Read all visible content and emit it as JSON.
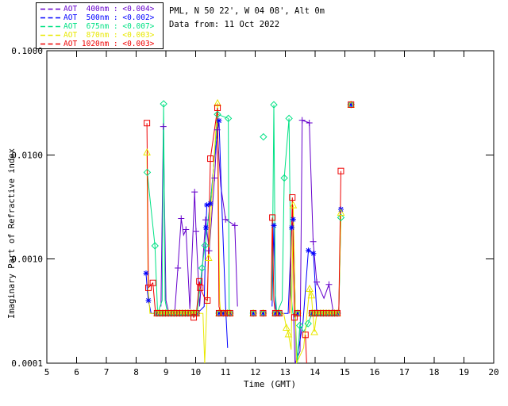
{
  "header": {
    "line1": "PML, N 50 22', W 04 08', Alt 0m",
    "line2": "Data from: 11 Oct 2022"
  },
  "chart_data": {
    "type": "line",
    "xlabel": "Time (GMT)",
    "ylabel": "Imaginary Part of Refractive index",
    "xlim": [
      5,
      20
    ],
    "ylim": [
      0.0001,
      0.1
    ],
    "y_scale": "log",
    "grid": false,
    "legend_position": "top-left-outside",
    "x_ticks": [
      5,
      6,
      7,
      8,
      9,
      10,
      11,
      12,
      13,
      14,
      15,
      16,
      17,
      18,
      19,
      20
    ],
    "y_ticks": [
      {
        "value": 0.1,
        "label": "0.1000"
      },
      {
        "value": 0.01,
        "label": "0.0100"
      },
      {
        "value": 0.001,
        "label": "0.0010"
      },
      {
        "value": 0.0001,
        "label": "0.0001"
      }
    ],
    "flat_value": 0.000302,
    "flat_times": [
      8.7,
      8.79,
      8.89,
      8.98,
      9.08,
      9.17,
      9.27,
      9.36,
      9.46,
      9.55,
      9.65,
      9.74,
      9.84,
      9.93,
      10.02,
      10.78,
      10.92,
      11.06,
      11.15,
      11.93,
      12.26,
      12.67,
      12.8,
      13.42,
      13.9,
      14.0,
      14.09,
      14.19,
      14.28,
      14.38,
      14.47,
      14.57,
      14.66,
      14.75
    ],
    "series": [
      {
        "name": "AOT 400nm",
        "legend_text": "AOT  400nm : <0.004>",
        "color": "#6600cc",
        "marker": "plus",
        "segments": [
          [
            [
              8.83,
              0.00035
            ],
            [
              8.91,
              0.0187
            ],
            [
              9.0,
              0.0004
            ],
            [
              9.1,
              0.0003
            ],
            [
              9.29,
              0.0003
            ],
            [
              9.4,
              0.00082
            ],
            [
              9.51,
              0.00245
            ],
            [
              9.59,
              0.0017
            ],
            [
              9.67,
              0.00192
            ],
            [
              9.8,
              0.00033
            ],
            [
              9.96,
              0.0044
            ],
            [
              10.01,
              0.00185
            ],
            [
              10.13,
              0.00035
            ],
            [
              10.33,
              0.00238
            ],
            [
              10.45,
              0.0012
            ],
            [
              10.63,
              0.006
            ],
            [
              10.72,
              0.0174
            ],
            [
              10.84,
              0.005
            ],
            [
              11.0,
              0.0024
            ],
            [
              11.31,
              0.0021
            ],
            [
              11.4,
              0.00035
            ]
          ],
          [
            [
              13.28,
              0.0003
            ],
            [
              13.33,
              0.0001
            ],
            [
              13.5,
              0.00013
            ],
            [
              13.57,
              0.0215
            ],
            [
              13.81,
              0.0203
            ],
            [
              13.94,
              0.00147
            ],
            [
              14.06,
              0.0006
            ],
            [
              14.3,
              0.00042
            ],
            [
              14.47,
              0.00057
            ],
            [
              14.62,
              0.0003
            ],
            [
              14.75,
              0.0003
            ]
          ]
        ],
        "markers": [
          [
            8.91,
            0.0187
          ],
          [
            9.4,
            0.00082
          ],
          [
            9.51,
            0.00245
          ],
          [
            9.67,
            0.00192
          ],
          [
            9.96,
            0.0044
          ],
          [
            10.01,
            0.00185
          ],
          [
            10.33,
            0.00238
          ],
          [
            10.45,
            0.0012
          ],
          [
            10.63,
            0.006
          ],
          [
            10.72,
            0.0174
          ],
          [
            11.0,
            0.0024
          ],
          [
            11.31,
            0.0021
          ],
          [
            13.57,
            0.0215
          ],
          [
            13.81,
            0.0203
          ],
          [
            13.94,
            0.00147
          ],
          [
            14.06,
            0.0006
          ],
          [
            14.47,
            0.00057
          ],
          [
            15.21,
            0.0304
          ]
        ]
      },
      {
        "name": "AOT 500nm",
        "legend_text": "AOT  500nm : <0.002>",
        "color": "#0000ff",
        "marker": "asterisk",
        "segments": [
          [
            [
              8.33,
              0.00073
            ],
            [
              8.37,
              0.0005
            ],
            [
              8.41,
              0.0004
            ],
            [
              8.5,
              0.0003
            ],
            [
              10.05,
              0.0003
            ],
            [
              10.28,
              0.00035
            ],
            [
              10.34,
              0.002
            ],
            [
              10.37,
              0.0033
            ],
            [
              10.49,
              0.0034
            ],
            [
              10.62,
              0.009
            ],
            [
              10.78,
              0.0213
            ],
            [
              10.88,
              0.003
            ],
            [
              11.0,
              0.00035
            ],
            [
              11.07,
              0.00014
            ]
          ],
          [
            [
              12.56,
              0.00035
            ],
            [
              12.62,
              0.0021
            ],
            [
              12.68,
              0.0003
            ],
            [
              13.1,
              0.0003
            ],
            [
              13.22,
              0.002
            ],
            [
              13.27,
              0.0024
            ],
            [
              13.33,
              0.00045
            ],
            [
              13.37,
              0.0001
            ],
            [
              13.6,
              0.00025
            ],
            [
              13.78,
              0.00121
            ],
            [
              13.95,
              0.00113
            ],
            [
              14.06,
              0.0003
            ],
            [
              14.75,
              0.0003
            ]
          ],
          [
            [
              14.8,
              0.0003
            ],
            [
              14.87,
              0.003
            ]
          ]
        ],
        "markers": [
          [
            8.33,
            0.00073
          ],
          [
            8.41,
            0.0004
          ],
          [
            10.34,
            0.002
          ],
          [
            10.37,
            0.0033
          ],
          [
            10.49,
            0.0034
          ],
          [
            10.78,
            0.0213
          ],
          [
            12.62,
            0.0021
          ],
          [
            13.22,
            0.002
          ],
          [
            13.27,
            0.0024
          ],
          [
            13.78,
            0.00121
          ],
          [
            13.95,
            0.00113
          ],
          [
            14.87,
            0.003
          ],
          [
            15.21,
            0.0304
          ]
        ]
      },
      {
        "name": "AOT 675nm",
        "legend_text": "AOT  675nm : <0.007>",
        "color": "#00e184",
        "marker": "diamond",
        "segments": [
          [
            [
              8.37,
              0.0068
            ],
            [
              8.63,
              0.00134
            ],
            [
              8.72,
              0.0003
            ],
            [
              8.87,
              0.0004
            ],
            [
              8.92,
              0.0309
            ],
            [
              8.97,
              0.0004
            ],
            [
              9.05,
              0.0003
            ],
            [
              10.05,
              0.0003
            ],
            [
              10.21,
              0.00082
            ],
            [
              10.31,
              0.00135
            ],
            [
              10.55,
              0.005
            ],
            [
              10.73,
              0.0245
            ],
            [
              11.09,
              0.0224
            ],
            [
              11.12,
              0.0003
            ],
            [
              11.16,
              0.0003
            ]
          ],
          [
            [
              12.56,
              0.0004
            ],
            [
              12.62,
              0.0303
            ],
            [
              12.67,
              0.00046
            ],
            [
              12.72,
              0.0003
            ],
            [
              12.9,
              0.0004
            ],
            [
              12.97,
              0.006
            ],
            [
              13.13,
              0.0224
            ],
            [
              13.2,
              0.00045
            ],
            [
              13.26,
              0.0003
            ],
            [
              13.33,
              0.0003
            ],
            [
              13.41,
              0.0001
            ],
            [
              13.49,
              0.00023
            ],
            [
              13.62,
              0.0002
            ],
            [
              13.77,
              0.00024
            ],
            [
              13.9,
              0.0003
            ],
            [
              14.75,
              0.0003
            ]
          ],
          [
            [
              14.8,
              0.0003
            ],
            [
              14.87,
              0.0025
            ]
          ]
        ],
        "markers": [
          [
            8.37,
            0.0068
          ],
          [
            8.63,
            0.00134
          ],
          [
            8.92,
            0.0309
          ],
          [
            10.21,
            0.00082
          ],
          [
            10.31,
            0.00135
          ],
          [
            10.73,
            0.0245
          ],
          [
            11.09,
            0.0224
          ],
          [
            12.27,
            0.0149
          ],
          [
            12.62,
            0.0303
          ],
          [
            12.97,
            0.006
          ],
          [
            13.13,
            0.0224
          ],
          [
            13.49,
            0.00023
          ],
          [
            13.77,
            0.00024
          ],
          [
            14.87,
            0.0025
          ],
          [
            15.21,
            0.0304
          ]
        ]
      },
      {
        "name": "AOT 870nm",
        "legend_text": "AOT  870nm : <0.003>",
        "color": "#e8e800",
        "marker": "triangle",
        "segments": [
          [
            [
              8.36,
              0.0106
            ],
            [
              8.4,
              0.00055
            ],
            [
              8.46,
              0.0003
            ],
            [
              10.24,
              0.0003
            ],
            [
              10.3,
              0.0001
            ],
            [
              10.43,
              0.00103
            ],
            [
              10.6,
              0.008
            ],
            [
              10.73,
              0.0315
            ],
            [
              10.8,
              0.0004
            ],
            [
              10.84,
              0.0003
            ],
            [
              11.08,
              0.0003
            ]
          ],
          [
            [
              12.67,
              0.0003
            ],
            [
              12.95,
              0.0003
            ],
            [
              13.04,
              0.00022
            ],
            [
              13.11,
              0.00019
            ],
            [
              13.2,
              0.000135
            ],
            [
              13.27,
              0.0033
            ],
            [
              13.38,
              0.0001
            ],
            [
              13.62,
              0.00014
            ],
            [
              13.82,
              0.00052
            ],
            [
              13.88,
              0.00045
            ],
            [
              13.98,
              0.0002
            ],
            [
              14.06,
              0.0003
            ],
            [
              14.75,
              0.0003
            ]
          ],
          [
            [
              14.8,
              0.0003
            ],
            [
              14.87,
              0.0028
            ]
          ]
        ],
        "markers": [
          [
            8.36,
            0.0106
          ],
          [
            10.43,
            0.00103
          ],
          [
            10.73,
            0.0315
          ],
          [
            13.04,
            0.00022
          ],
          [
            13.11,
            0.00019
          ],
          [
            13.27,
            0.0033
          ],
          [
            13.82,
            0.00052
          ],
          [
            13.88,
            0.00045
          ],
          [
            13.98,
            0.0002
          ],
          [
            14.87,
            0.0028
          ],
          [
            15.21,
            0.0304
          ]
        ]
      },
      {
        "name": "AOT 1020nm",
        "legend_text": "AOT 1020nm : <0.003>",
        "color": "#ee0000",
        "marker": "square",
        "segments": [
          [
            [
              8.36,
              0.0202
            ],
            [
              8.41,
              0.00053
            ],
            [
              8.56,
              0.00059
            ],
            [
              8.65,
              0.0003
            ],
            [
              9.9,
              0.0003
            ],
            [
              9.93,
              0.000275
            ],
            [
              10.02,
              0.0003
            ],
            [
              10.12,
              0.00061
            ],
            [
              10.15,
              0.00053
            ],
            [
              10.3,
              0.00042
            ],
            [
              10.39,
              0.0004
            ],
            [
              10.49,
              0.0092
            ],
            [
              10.73,
              0.0283
            ],
            [
              10.78,
              0.00035
            ],
            [
              10.84,
              0.0003
            ],
            [
              11.16,
              0.0003
            ]
          ],
          [
            [
              12.53,
              0.0004
            ],
            [
              12.57,
              0.0025
            ],
            [
              12.62,
              0.0004
            ],
            [
              12.67,
              0.0003
            ],
            [
              12.8,
              0.0003
            ]
          ],
          [
            [
              13.15,
              0.0003
            ],
            [
              13.24,
              0.0039
            ],
            [
              13.31,
              0.000275
            ]
          ],
          [
            [
              13.68,
              0.000187
            ],
            [
              13.72,
              0.0001
            ]
          ],
          [
            [
              13.9,
              0.0003
            ],
            [
              14.75,
              0.0003
            ],
            [
              14.8,
              0.0003
            ],
            [
              14.87,
              0.007
            ]
          ]
        ],
        "markers": [
          [
            8.36,
            0.0202
          ],
          [
            8.41,
            0.00053
          ],
          [
            8.56,
            0.00059
          ],
          [
            9.93,
            0.000275
          ],
          [
            10.12,
            0.00061
          ],
          [
            10.15,
            0.00053
          ],
          [
            10.39,
            0.0004
          ],
          [
            10.49,
            0.0092
          ],
          [
            10.73,
            0.0283
          ],
          [
            12.57,
            0.0025
          ],
          [
            13.24,
            0.0039
          ],
          [
            13.31,
            0.000275
          ],
          [
            13.68,
            0.000187
          ],
          [
            14.87,
            0.007
          ],
          [
            15.21,
            0.0304
          ]
        ]
      }
    ]
  }
}
